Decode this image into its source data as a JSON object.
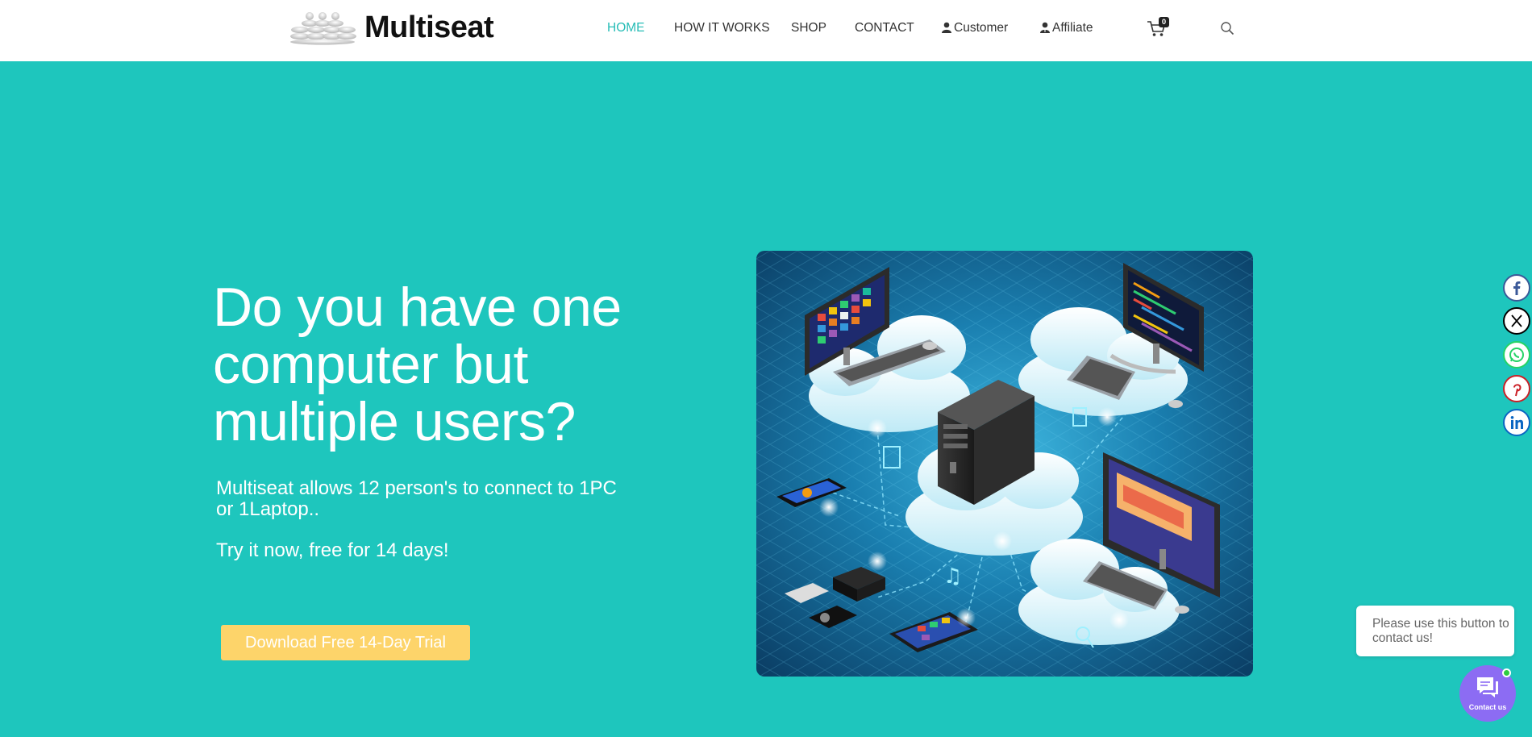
{
  "brand": {
    "name": "Multiseat"
  },
  "nav": {
    "home": "HOME",
    "how_it_works": "HOW IT WORKS",
    "shop": "SHOP",
    "contact": "CONTACT",
    "customer": "Customer",
    "affiliate": "Affiliate"
  },
  "cart": {
    "count": "0",
    "icon": "cart-icon"
  },
  "search": {
    "icon": "search-icon"
  },
  "hero": {
    "title": "Do you have one computer but multiple users?",
    "subtitle": "Multiseat allows 12 person's to connect to 1PC or 1Laptop..",
    "trial_text": "Try it now, free for 14 days!",
    "cta_label": "Download Free 14-Day Trial"
  },
  "social": [
    {
      "name": "facebook",
      "icon": "facebook-icon",
      "color": "#3b5998"
    },
    {
      "name": "x",
      "icon": "x-icon",
      "color": "#000000"
    },
    {
      "name": "whatsapp",
      "icon": "whatsapp-icon",
      "color": "#25d366"
    },
    {
      "name": "pinterest",
      "icon": "pinterest-icon",
      "color": "#cb2027"
    },
    {
      "name": "linkedin",
      "icon": "linkedin-icon",
      "color": "#0a66c2"
    }
  ],
  "contact_widget": {
    "bubble_text": "Please use this button to contact us!",
    "button_label": "Contact us"
  },
  "colors": {
    "hero_bg": "#1ec6bd",
    "accent": "#26bcb6",
    "cta_bg": "#fdd46a",
    "contact_button": "#8c6cf3"
  }
}
